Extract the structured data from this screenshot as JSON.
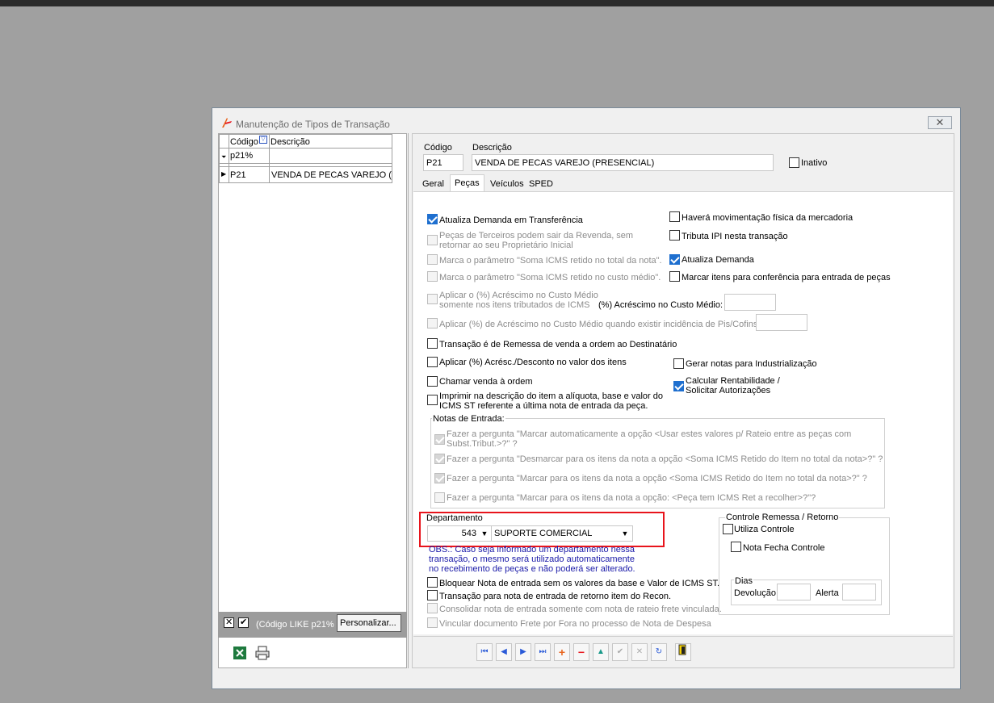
{
  "window": {
    "title": "Manutenção de Tipos de Transação",
    "close_symbol": "✕"
  },
  "grid": {
    "col_codigo": "Código",
    "col_descricao": "Descrição",
    "filter_value": "p21%",
    "rows": [
      {
        "codigo": "P21",
        "descricao": "VENDA DE PECAS VAREJO (PRI"
      }
    ],
    "filter_text": "(Código LIKE p21%",
    "customize_label": "Personalizar..."
  },
  "header": {
    "codigo_label": "Código",
    "descricao_label": "Descrição",
    "codigo_value": "P21",
    "descricao_value": "VENDA DE PECAS VAREJO (PRESENCIAL)",
    "inativo_label": "Inativo"
  },
  "tabs": [
    "Geral",
    "Peças",
    "Veículos",
    "SPED"
  ],
  "pecas": {
    "atualiza_demanda_transf": "Atualiza Demanda em Transferência",
    "pecas_terceiros": "Peças de Terceiros podem sair da Revenda, sem retornar ao seu Proprietário Inicial",
    "marca_soma_total": "Marca o parâmetro \"Soma ICMS retido no total da nota\".",
    "marca_soma_custo": "Marca o parâmetro \"Soma ICMS retido no custo médio\".",
    "aplicar_acrescimo": "Aplicar o (%) Acréscimo no Custo Médio somente nos itens tributados de ICMS",
    "acrescimo_label": "(%) Acréscimo no Custo Médio:",
    "aplicar_pis": "Aplicar (%) de Acréscimo no Custo Médio quando existir incidência de Pis/Cofins:",
    "remessa_venda": "Transação é de Remessa de venda a ordem ao Destinatário",
    "aplicar_desconto": "Aplicar (%) Acrésc./Desconto no valor dos itens",
    "chamar_venda": "Chamar venda à ordem",
    "imprimir_desc": "Imprimir na descrição do item a alíquota, base e valor do ICMS ST referente a última nota de entrada da peça.",
    "havera_mov": "Haverá movimentação física da mercadoria",
    "tributa_ipi": "Tributa IPI nesta transação",
    "atualiza_demanda": "Atualiza Demanda",
    "marcar_itens": "Marcar itens para conferência para entrada de peças",
    "gerar_notas": "Gerar notas para Industrialização",
    "calcular_rent": "Calcular Rentabilidade / Solicitar Autorizações",
    "notas_entrada_title": "Notas de Entrada:",
    "ne1": "Fazer a pergunta \"Marcar automaticamente a opção <Usar estes valores p/ Rateio entre as peças com Subst.Tribut.>?\" ?",
    "ne2": "Fazer a pergunta \"Desmarcar para os itens da nota a opção <Soma ICMS Retido do Item no total da nota>?\" ?",
    "ne3": "Fazer a pergunta \"Marcar para os itens da nota a opção <Soma ICMS Retido do Item no total da nota>?\" ?",
    "ne4": "Fazer a pergunta \"Marcar para os itens da nota a opção: <Peça tem ICMS Ret a recolher>?\"?",
    "departamento_label": "Departamento",
    "dept_code": "543",
    "dept_name": "SUPORTE COMERCIAL",
    "obs": "OBS.: Caso seja informado um departamento nessa transação, o mesmo será utilizado automaticamente no recebimento de peças e não poderá ser alterado.",
    "bloquear_nota": "Bloquear Nota de entrada sem os valores da base e Valor de ICMS ST.",
    "transacao_retorno": "Transação para nota de entrada de retorno item do Recon.",
    "consolidar": "Consolidar nota de entrada somente com nota de rateio frete vinculada.",
    "vincular_frete": "Vincular documento Frete por Fora no processo de Nota de Despesa",
    "controle_title": "Controle Remessa / Retorno",
    "utiliza_controle": "Utiliza Controle",
    "nota_fecha": "Nota Fecha Controle",
    "dias_title": "Dias",
    "devolucao": "Devolução",
    "alerta": "Alerta"
  },
  "colors": {
    "highlight": "#e8141c",
    "obs_text": "#1a1aa8",
    "check_blue": "#1e6fcf"
  }
}
